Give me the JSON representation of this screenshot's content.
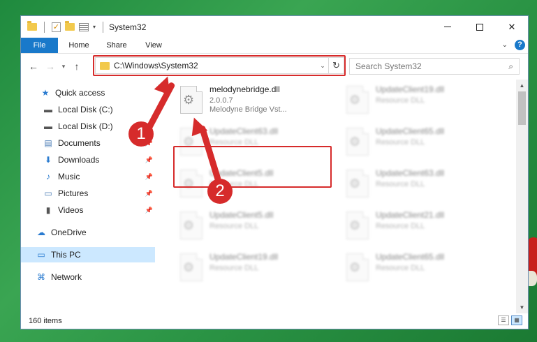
{
  "window": {
    "title": "System32",
    "minimize_glyph": "",
    "maximize_glyph": "",
    "close_glyph": "✕"
  },
  "ribbon": {
    "tabs": [
      "File",
      "Home",
      "Share",
      "View"
    ],
    "collapse_glyph": "⌄",
    "help_glyph": "?"
  },
  "address": {
    "path": "C:\\Windows\\System32",
    "search_placeholder": "Search System32"
  },
  "navigation": {
    "items": [
      {
        "label": "Quick access",
        "icon": "star-icon",
        "pinned": false
      },
      {
        "label": "Local Disk (C:)",
        "icon": "drive-icon",
        "pinned": false
      },
      {
        "label": "Local Disk (D:)",
        "icon": "drive-icon",
        "pinned": false
      },
      {
        "label": "Documents",
        "icon": "document-icon",
        "pinned": true
      },
      {
        "label": "Downloads",
        "icon": "download-icon",
        "pinned": true
      },
      {
        "label": "Music",
        "icon": "music-icon",
        "pinned": true
      },
      {
        "label": "Pictures",
        "icon": "picture-icon",
        "pinned": true
      },
      {
        "label": "Videos",
        "icon": "video-icon",
        "pinned": true
      },
      {
        "label": "OneDrive",
        "icon": "cloud-icon",
        "pinned": false
      },
      {
        "label": "This PC",
        "icon": "computer-icon",
        "pinned": false,
        "selected": true
      },
      {
        "label": "Network",
        "icon": "network-icon",
        "pinned": false
      }
    ]
  },
  "files": [
    {
      "name": "melodynebridge.dll",
      "line2": "2.0.0.7",
      "line3": "Melodyne Bridge Vst...",
      "highlighted": true
    },
    {
      "name": "UpdateClient19.dll",
      "line2": "Resource DLL"
    },
    {
      "name": "UpdateClient63.dll",
      "line2": "Resource DLL"
    },
    {
      "name": "UpdateClient65.dll",
      "line2": "Resource DLL"
    },
    {
      "name": "UpdateClient5.dll",
      "line2": "Resource DLL"
    },
    {
      "name": "UpdateClient63.dll",
      "line2": "Resource DLL"
    },
    {
      "name": "UpdateClient5.dll",
      "line2": "Resource DLL"
    },
    {
      "name": "UpdateClient21.dll",
      "line2": "Resource DLL"
    },
    {
      "name": "UpdateClient19.dll",
      "line2": "Resource DLL"
    },
    {
      "name": "UpdateClient65.dll",
      "line2": "Resource DLL"
    }
  ],
  "status": {
    "item_count": "160 items"
  },
  "callouts": [
    "1",
    "2"
  ],
  "colors": {
    "accent": "#1979ca",
    "highlight": "#d62b2b",
    "selected_nav": "#cce8ff"
  }
}
